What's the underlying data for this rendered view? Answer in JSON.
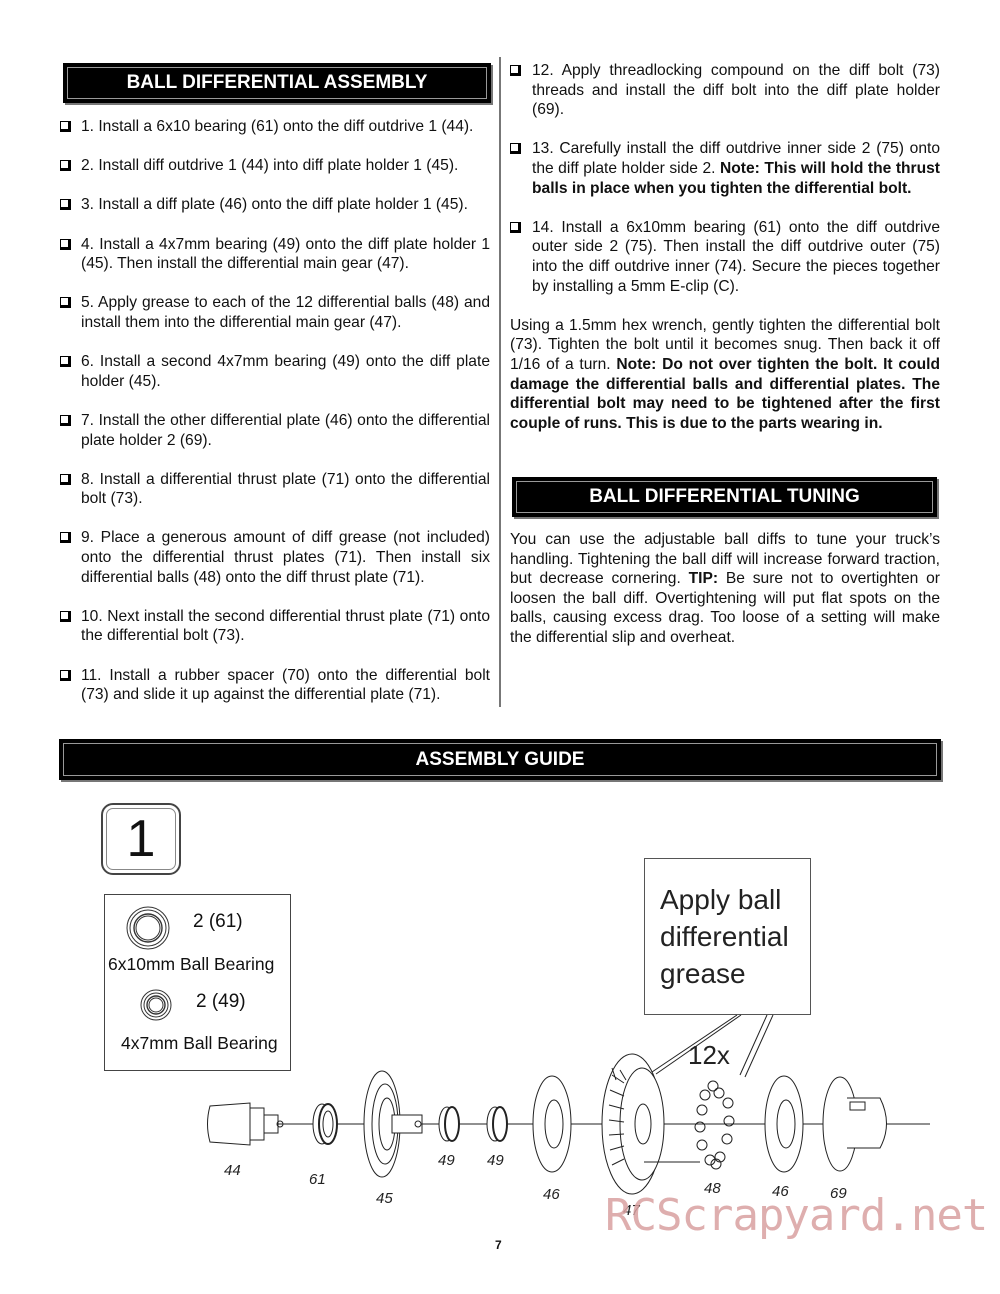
{
  "left": {
    "header": "BALL DIFFERENTIAL ASSEMBLY",
    "steps": [
      {
        "text": "1. Install a 6x10 bearing (61) onto the diff outdrive 1 (44)."
      },
      {
        "text": "2. Install diff outdrive 1 (44) into diff plate holder 1 (45)."
      },
      {
        "text": "3. Install a diff plate (46) onto the diff plate holder 1 (45)."
      },
      {
        "text": "4. Install a 4x7mm bearing (49) onto the diff plate holder 1 (45). Then install the differential main gear (47)."
      },
      {
        "text": " 5. Apply grease to each of the 12 differential balls (48) and install them into the differential main gear (47)."
      },
      {
        "text": "6. Install a second 4x7mm bearing (49) onto the diff plate holder (45)."
      },
      {
        "text": "7. Install the other differential plate (46) onto the differential plate holder 2 (69)."
      },
      {
        "text": "8. Install a differential thrust plate (71) onto the differential bolt (73)."
      },
      {
        "text": "9. Place a generous amount of diff grease (not included) onto the differential thrust plates (71). Then install six differential balls (48) onto the diff thrust plate (71)."
      },
      {
        "text": "10. Next install the second differential thrust plate (71) onto the differential bolt (73)."
      },
      {
        "text": "11. Install a rubber spacer (70) onto the differential bolt (73) and slide it up against the differential plate (71)."
      }
    ]
  },
  "right": {
    "steps": [
      {
        "text": "12. Apply threadlocking compound on the diff bolt (73) threads and install the diff bolt into the diff plate holder (69).",
        "bold": ""
      },
      {
        "text": "13. Carefully install the diff outdrive inner side 2 (75) onto the diff plate holder side 2. ",
        "bold": "Note: This will hold the thrust balls in place when you tighten the differential bolt."
      },
      {
        "text": "14. Install a 6x10mm bearing (61) onto the diff outdrive outer side 2 (75). Then install the diff outdrive outer (75) into the diff outdrive inner (74). Secure the pieces together by installing a 5mm E-clip (C).",
        "bold": ""
      }
    ],
    "tighten_note": {
      "text": "Using a 1.5mm hex wrench, gently tighten the differential bolt (73). Tighten the bolt until it becomes snug. Then back it off 1/16 of a turn. ",
      "bold": "Note: Do not over tighten the bolt. It could damage the differential balls and differential plates. The differential bolt may need to be tightened after the first couple of runs. This is due to the parts wearing in."
    },
    "tuning_header": "BALL DIFFERENTIAL TUNING",
    "tuning": {
      "text_before": "You can use the adjustable ball diffs to tune your truck’s handling. Tightening the ball diff will increase forward traction, but decrease cornering. ",
      "tip_label": "TIP:",
      "text_after": " Be sure not to overtighten or loosen the ball diff. Overtightening will put flat spots on the balls, causing excess drag. Too loose of a setting will make the differential slip and overheat."
    }
  },
  "guide": {
    "header": "ASSEMBLY GUIDE",
    "step_number": "1",
    "parts_box": [
      {
        "qty": "2 (61)",
        "name": "6x10mm Ball Bearing"
      },
      {
        "qty": "2 (49)",
        "name": "4x7mm Ball Bearing"
      }
    ],
    "callout": "Apply ball differential grease",
    "ball_count": "12x",
    "part_labels": [
      "44",
      "61",
      "45",
      "49",
      "49",
      "46",
      "47",
      "48",
      "46",
      "69"
    ]
  },
  "watermark": "RCScrapyard.net",
  "page_number": "7"
}
